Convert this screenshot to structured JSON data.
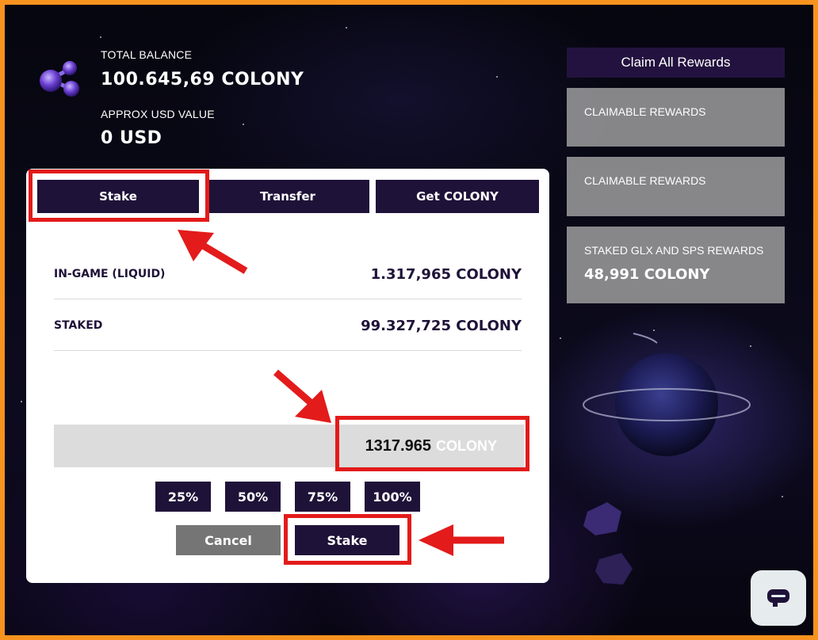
{
  "header": {
    "total_balance_label": "TOTAL BALANCE",
    "total_balance_value": "100.645,69 COLONY",
    "usd_label": "APPROX USD VALUE",
    "usd_value": "0 USD"
  },
  "sidebar": {
    "claim_all_label": "Claim All Rewards",
    "cards": [
      {
        "label": "CLAIMABLE REWARDS",
        "value": ""
      },
      {
        "label": "CLAIMABLE REWARDS",
        "value": ""
      },
      {
        "label": "STAKED GLX AND SPS REWARDS",
        "value": "48,991 COLONY"
      }
    ]
  },
  "tabs": [
    {
      "label": "Stake",
      "active": true
    },
    {
      "label": "Transfer",
      "active": false
    },
    {
      "label": "Get COLONY",
      "active": false
    }
  ],
  "balances": [
    {
      "label": "IN-GAME (LIQUID)",
      "value": "1.317,965 COLONY"
    },
    {
      "label": "STAKED",
      "value": "99.327,725 COLONY"
    }
  ],
  "amount_input": {
    "value": "1317.965",
    "unit": "COLONY"
  },
  "percent_buttons": [
    "25%",
    "50%",
    "75%",
    "100%"
  ],
  "actions": {
    "cancel_label": "Cancel",
    "stake_label": "Stake"
  },
  "colors": {
    "accent": "#1f1238",
    "highlight": "#e31b1b",
    "border": "#f7931e",
    "card_gray": "#aaaaaa"
  },
  "icons": [
    "colony-logo-icon",
    "chat-icon",
    "arrow-annotation-icon"
  ]
}
